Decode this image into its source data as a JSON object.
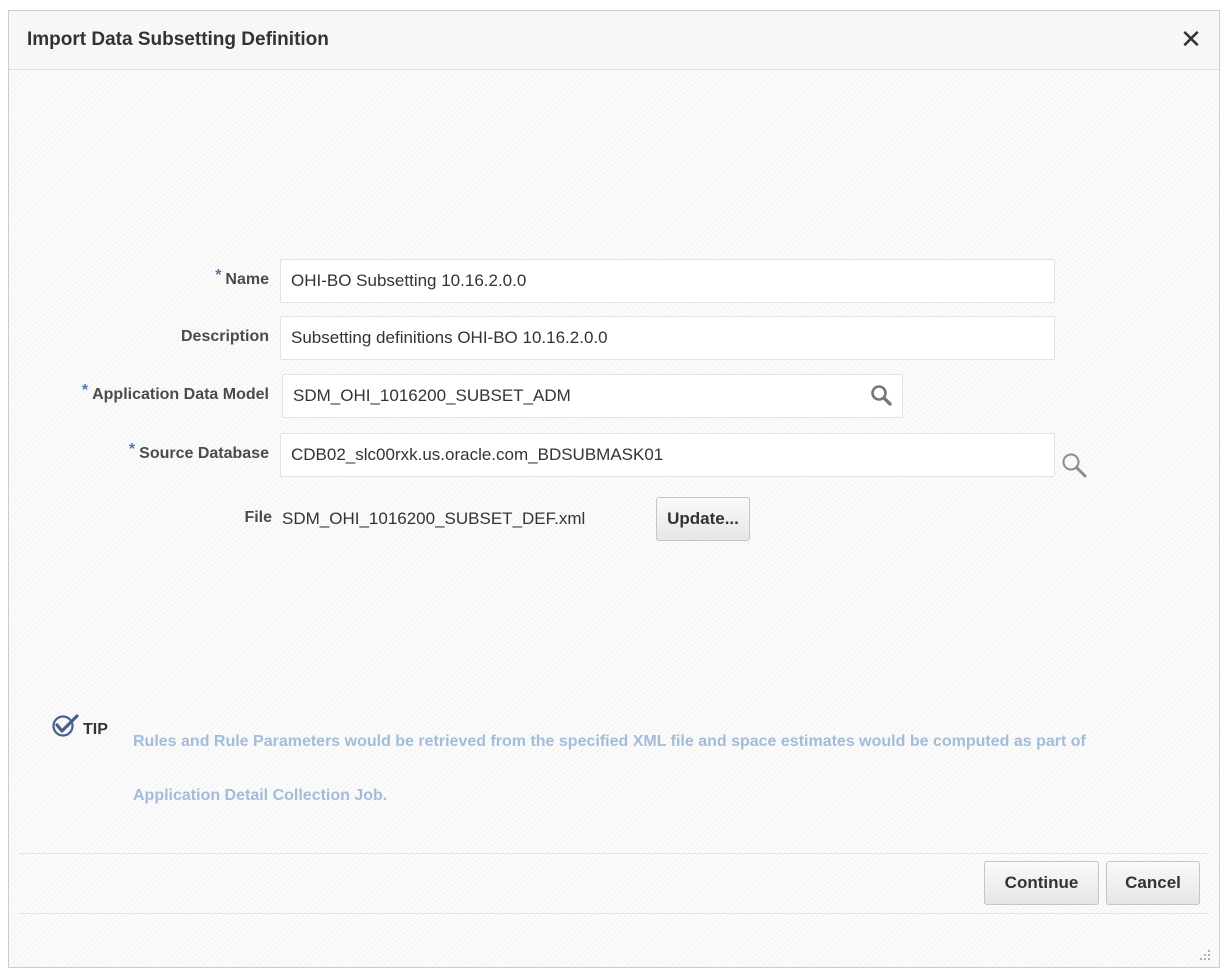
{
  "dialog": {
    "title": "Import Data Subsetting Definition",
    "close_icon": "close-icon"
  },
  "form": {
    "name": {
      "label": "Name",
      "required": true,
      "value": "OHI-BO Subsetting 10.16.2.0.0"
    },
    "description": {
      "label": "Description",
      "required": false,
      "value": "Subsetting definitions OHI-BO 10.16.2.0.0"
    },
    "application_data_model": {
      "label": "Application Data Model",
      "required": true,
      "value": "SDM_OHI_1016200_SUBSET_ADM",
      "icon": "search-icon"
    },
    "source_database": {
      "label": "Source Database",
      "required": true,
      "value": "CDB02_slc00rxk.us.oracle.com_BDSUBMASK01",
      "icon": "search-icon"
    },
    "file": {
      "label": "File",
      "value": "SDM_OHI_1016200_SUBSET_DEF.xml",
      "update_label": "Update..."
    },
    "required_marker": "*"
  },
  "tip": {
    "icon": "checkmark-icon",
    "label": "TIP",
    "text": "Rules and Rule Parameters would be retrieved from the specified XML file and space estimates would be computed as part of Application Detail Collection Job."
  },
  "footer": {
    "continue_label": "Continue",
    "cancel_label": "Cancel"
  },
  "colors": {
    "required": "#4a7bb0",
    "tip_text": "#a3bcd9",
    "border": "#c4ced7"
  }
}
